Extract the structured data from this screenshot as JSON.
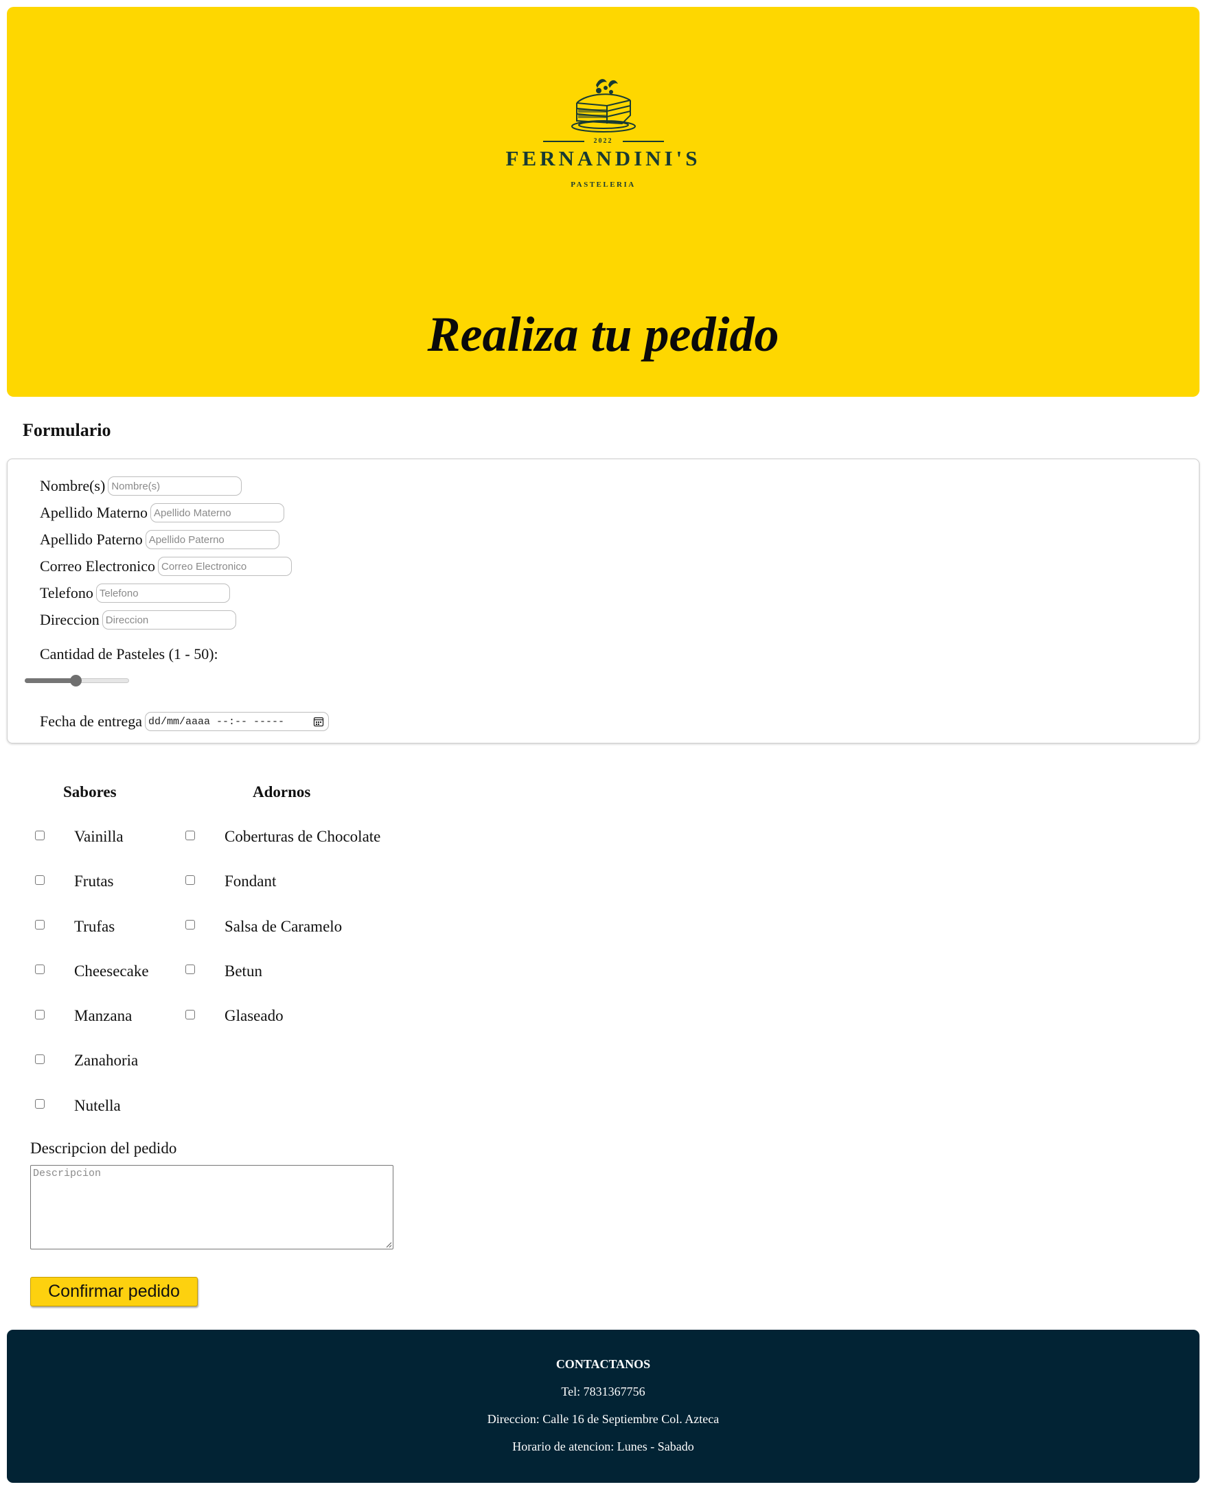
{
  "header": {
    "logo": {
      "year": "2022",
      "name": "FERNANDINI'S",
      "subtitle": "PASTELERIA",
      "color": "#173a33"
    },
    "title": "Realiza tu pedido",
    "background": "#fed700"
  },
  "form": {
    "heading": "Formulario",
    "fields": [
      {
        "label": "Nombre(s)",
        "placeholder": "Nombre(s)"
      },
      {
        "label": "Apellido Materno",
        "placeholder": "Apellido Materno"
      },
      {
        "label": "Apellido Paterno",
        "placeholder": "Apellido Paterno"
      },
      {
        "label": "Correo Electronico",
        "placeholder": "Correo Electronico"
      },
      {
        "label": "Telefono",
        "placeholder": "Telefono"
      },
      {
        "label": "Direccion",
        "placeholder": "Direccion"
      }
    ],
    "quantity": {
      "label": "Cantidad de Pasteles (1 - 50):",
      "min": 1,
      "max": 50,
      "value": 25
    },
    "delivery": {
      "label": "Fecha de entrega",
      "placeholder_text": "dd/mm/aaaa --:-- -----",
      "icon": "calendar-icon"
    }
  },
  "options": {
    "sabores_heading": "Sabores",
    "adornos_heading": "Adornos",
    "sabores": [
      "Vainilla",
      "Frutas",
      "Trufas",
      "Cheesecake",
      "Manzana",
      "Zanahoria",
      "Nutella"
    ],
    "adornos": [
      "Coberturas de Chocolate",
      "Fondant",
      "Salsa de Caramelo",
      "Betun",
      "Glaseado"
    ]
  },
  "description": {
    "label": "Descripcion del pedido",
    "placeholder": "Descripcion"
  },
  "confirm_button": {
    "label": "Confirmar pedido",
    "color": "#fdd10f"
  },
  "footer": {
    "title": "CONTACTANOS",
    "tel": "Tel: 7831367756",
    "address": "Direccion: Calle 16 de Septiembre Col. Azteca",
    "hours": "Horario de atencion: Lunes - Sabado",
    "background": "#022334"
  }
}
